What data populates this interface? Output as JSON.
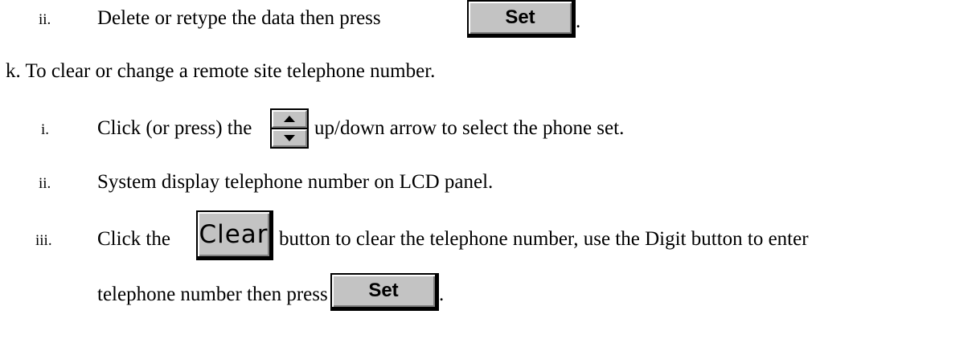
{
  "step_ii_a": {
    "numeral": "ii.",
    "text": "Delete or retype the data then press",
    "set_button": "Set",
    "end": "."
  },
  "step_k": {
    "text": "k.   To clear or change a remote site telephone number."
  },
  "step_k_i": {
    "numeral": "i.",
    "text_before": "Click (or press) the",
    "text_after": "up/down arrow to select the phone set.",
    "icon": "up-down-spinner"
  },
  "step_k_ii": {
    "numeral": "ii.",
    "text": "System display telephone number on LCD panel."
  },
  "step_k_iii": {
    "numeral": "iii.",
    "text_before": "Click the",
    "clear_button": "Clear",
    "text_after": "button to clear the telephone number, use the Digit button to enter",
    "text_line2": "telephone number then press",
    "set_button": "Set",
    "end": "."
  },
  "colors": {
    "button_face": "#c3c3c3",
    "text": "#000000"
  }
}
